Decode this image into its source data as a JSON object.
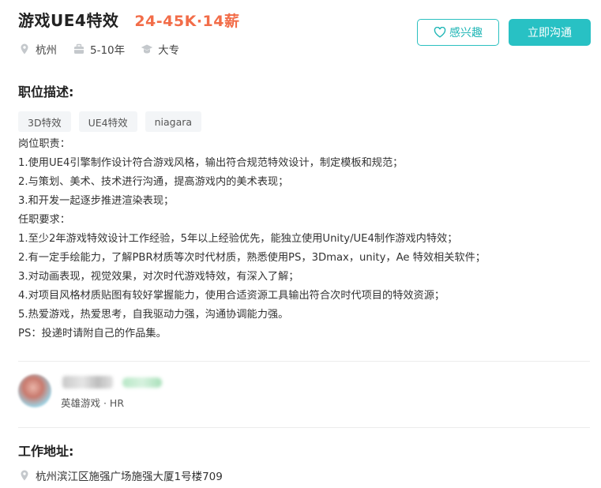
{
  "job": {
    "title": "游戏UE4特效",
    "salary": "24-45K·14薪",
    "location": "杭州",
    "experience": "5-10年",
    "education": "大专"
  },
  "actions": {
    "interest_label": "感兴趣",
    "chat_label": "立即沟通"
  },
  "description": {
    "section_title": "职位描述:",
    "tags": [
      "3D特效",
      "UE4特效",
      "niagara"
    ],
    "lines": [
      "岗位职责：",
      "1.使用UE4引擎制作设计符合游戏风格，输出符合规范特效设计，制定模板和规范；",
      "2.与策划、美术、技术进行沟通，提高游戏内的美术表现；",
      "3.和开发一起逐步推进渲染表现；",
      "任职要求：",
      "1.至少2年游戏特效设计工作经验，5年以上经验优先，能独立使用Unity/UE4制作游戏内特效；",
      "2.有一定手绘能力，了解PBR材质等次时代材质，熟悉使用PS，3Dmax，unity，Ae 特效相关软件；",
      "3.对动画表现，视觉效果，对次时代游戏特效，有深入了解；",
      "4.对项目风格材质贴图有较好掌握能力，使用合适资源工具输出符合次时代项目的特效资源；",
      "5.热爱游戏，热爱思考，自我驱动力强，沟通协调能力强。",
      "PS：投递时请附自己的作品集。"
    ]
  },
  "recruiter": {
    "info": "英雄游戏 · HR"
  },
  "address": {
    "section_title": "工作地址:",
    "text": "杭州滨江区施强广场施强大厦1号楼709"
  },
  "colors": {
    "salary": "#f26d49",
    "accent": "#28c1c4"
  }
}
